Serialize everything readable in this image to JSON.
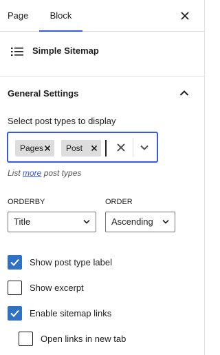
{
  "tabs": {
    "page_label": "Page",
    "block_label": "Block"
  },
  "block_card": {
    "title": "Simple Sitemap"
  },
  "panel": {
    "title": "General Settings",
    "post_types_label": "Select post types to display",
    "tokens": [
      "Pages",
      "Post"
    ],
    "help_prefix": "List ",
    "help_link": "more",
    "help_suffix": " post types",
    "orderby": {
      "label": "ORDERBY",
      "value": "Title"
    },
    "order": {
      "label": "ORDER",
      "value": "Ascending"
    },
    "checkboxes": [
      {
        "label": "Show post type label",
        "checked": true
      },
      {
        "label": "Show excerpt",
        "checked": false
      },
      {
        "label": "Enable sitemap links",
        "checked": true
      },
      {
        "label": "Open links in new tab",
        "checked": false
      }
    ]
  },
  "colors": {
    "accent": "#3858e9",
    "checkbox_fill": "#2f72c5",
    "border": "#e0e0e0"
  }
}
